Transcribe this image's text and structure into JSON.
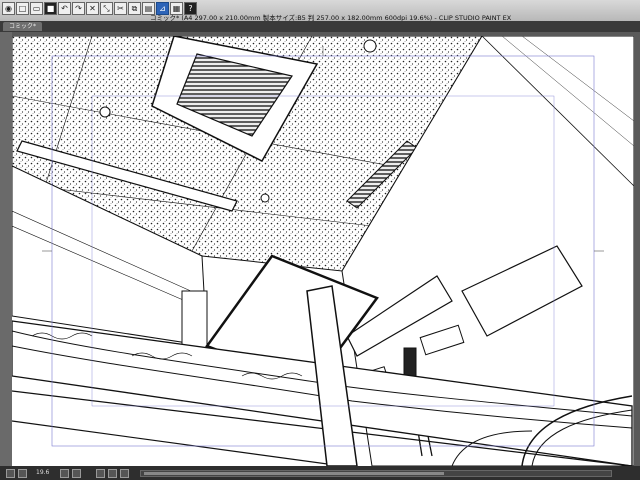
{
  "window": {
    "title": "コミック* (A4 297.00 x 210.00mm 製本サイズ:B5 判 257.00 x 182.00mm 600dpi 19.6%) - CLIP STUDIO PAINT EX"
  },
  "tabs": [
    {
      "label": "コミック*"
    }
  ],
  "toolbar": {
    "icons": [
      "app-menu-icon",
      "new-icon",
      "open-icon",
      "save-icon",
      "undo-icon",
      "redo-icon",
      "clear-icon",
      "transform-icon",
      "cut-icon",
      "copy-icon",
      "paste-icon",
      "ruler-icon",
      "grid-icon",
      "help-icon"
    ]
  },
  "status": {
    "zoom": "19.6"
  },
  "colors": {
    "titlebar": "#c8c8c8",
    "canvas_bg": "#ffffff",
    "workspace": "#5a5a5a",
    "accent": "#2d64b8"
  }
}
